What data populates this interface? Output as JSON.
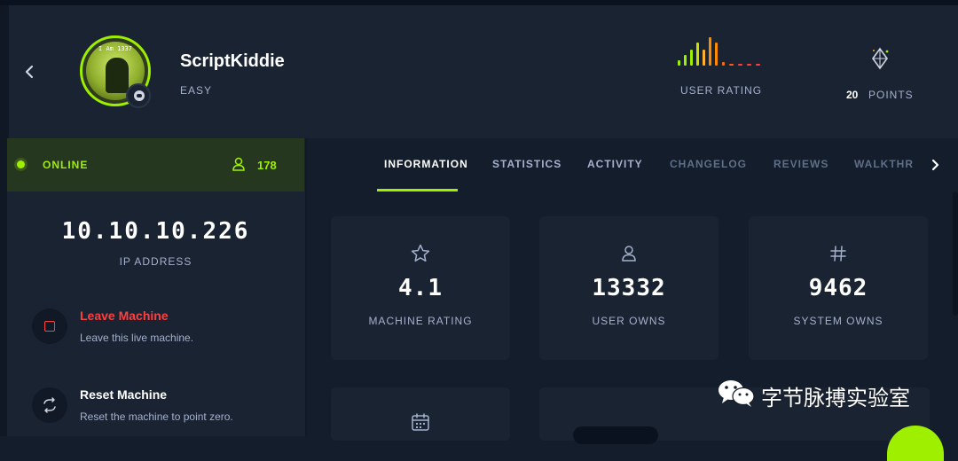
{
  "header": {
    "machine_name": "ScriptKiddie",
    "difficulty": "EASY",
    "avatar_caption": "I Am 1337",
    "user_rating_label": "USER RATING",
    "points_value": "20",
    "points_label": "POINTS"
  },
  "status": {
    "label": "ONLINE",
    "players": "178"
  },
  "ip": {
    "value": "10.10.10.226",
    "label": "IP ADDRESS"
  },
  "actions": {
    "leave_title": "Leave Machine",
    "leave_desc": "Leave this live machine.",
    "reset_title": "Reset Machine",
    "reset_desc": "Reset the machine to point zero."
  },
  "tabs": [
    {
      "label": "INFORMATION"
    },
    {
      "label": "STATISTICS"
    },
    {
      "label": "ACTIVITY"
    },
    {
      "label": "CHANGELOG"
    },
    {
      "label": "REVIEWS"
    },
    {
      "label": "WALKTHR"
    }
  ],
  "stats": [
    {
      "icon": "star-icon",
      "value": "4.1",
      "label": "MACHINE RATING"
    },
    {
      "icon": "user-icon",
      "value": "13332",
      "label": "USER OWNS"
    },
    {
      "icon": "hash-icon",
      "value": "9462",
      "label": "SYSTEM OWNS"
    }
  ],
  "watermark": {
    "text": "字节脉搏实验室"
  },
  "colors": {
    "accent": "#9fef00",
    "danger": "#ff3e3e",
    "background": "#141d2b",
    "panel": "#1a2332",
    "muted_text": "#a4b1cd"
  }
}
